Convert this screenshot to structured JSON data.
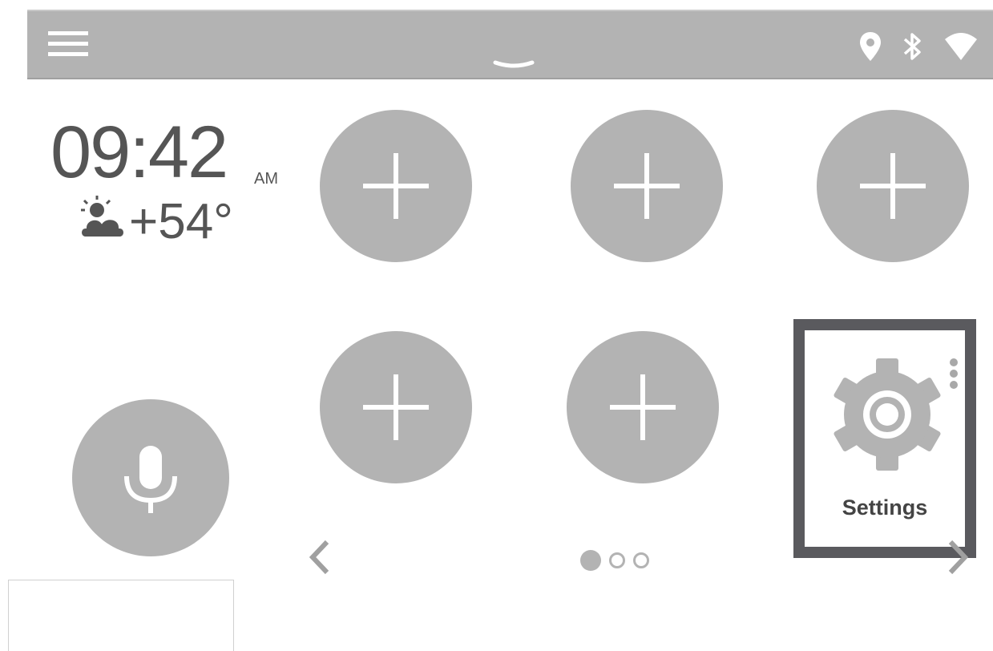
{
  "status_bar": {
    "menu_icon": "hamburger-menu-icon",
    "pulldown_icon": "chevron-down-handle-icon",
    "icons": [
      "location-pin-icon",
      "bluetooth-icon",
      "wifi-icon"
    ]
  },
  "clock": {
    "time": "09:42",
    "period": "AM"
  },
  "weather": {
    "icon": "partly-cloudy-icon",
    "temperature": "+54°"
  },
  "tiles": [
    {
      "type": "add",
      "icon": "plus-icon"
    },
    {
      "type": "add",
      "icon": "plus-icon"
    },
    {
      "type": "add",
      "icon": "plus-icon"
    },
    {
      "type": "add",
      "icon": "plus-icon"
    },
    {
      "type": "add",
      "icon": "plus-icon"
    }
  ],
  "settings_tile": {
    "label": "Settings",
    "icon": "gear-icon",
    "more_icon": "more-vertical-icon"
  },
  "voice": {
    "icon": "microphone-icon"
  },
  "pagination": {
    "current_page": 1,
    "total_pages": 3,
    "prev_icon": "chevron-left-icon",
    "next_icon": "chevron-right-icon"
  },
  "colors": {
    "tile_gray": "#b3b3b3",
    "text_gray": "#555555",
    "highlight_border": "#5a5a5e",
    "topbar_gray": "#b3b3b3"
  }
}
